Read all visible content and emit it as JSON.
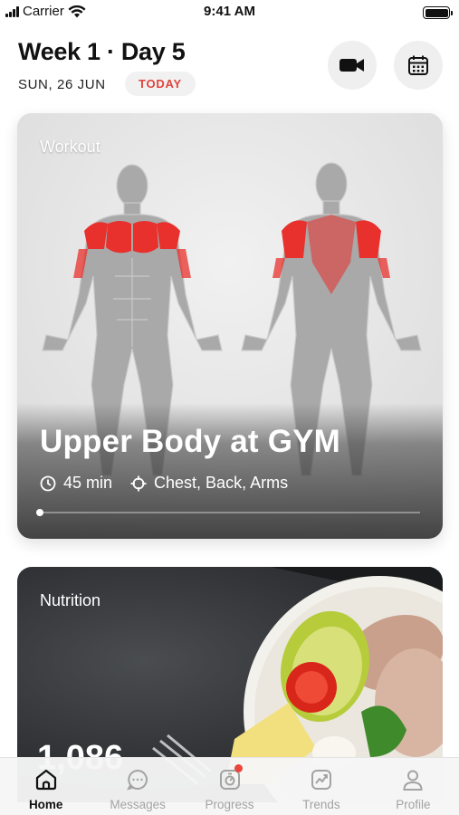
{
  "status_bar": {
    "carrier": "Carrier",
    "time": "9:41 AM"
  },
  "header": {
    "title": "Week 1 · Day 5",
    "date": "SUN, 26 JUN",
    "today_badge": "TODAY",
    "video_icon": "video-camera-icon",
    "calendar_icon": "calendar-icon"
  },
  "workout": {
    "label": "Workout",
    "title": "Upper Body at GYM",
    "duration": "45 min",
    "muscles": "Chest, Back, Arms",
    "progress": 0.0,
    "highlight_color": "#e8302c"
  },
  "nutrition": {
    "label": "Nutrition",
    "value": "1,086"
  },
  "tabs": [
    {
      "label": "Home",
      "icon": "home-icon",
      "active": true
    },
    {
      "label": "Messages",
      "icon": "chat-bubble-icon",
      "active": false
    },
    {
      "label": "Progress",
      "icon": "progress-icon",
      "active": false,
      "badge": true
    },
    {
      "label": "Trends",
      "icon": "trends-chart-icon",
      "active": false
    },
    {
      "label": "Profile",
      "icon": "person-icon",
      "active": false
    }
  ],
  "colors": {
    "accent": "#e0443c",
    "active_tab": "#111111",
    "inactive_tab": "#a3a3a3"
  }
}
